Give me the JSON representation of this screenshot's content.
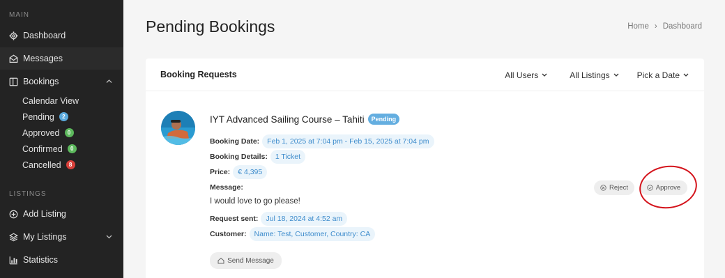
{
  "sidebar": {
    "main_section": "MAIN",
    "items": [
      {
        "label": "Dashboard",
        "icon": "gear-icon"
      },
      {
        "label": "Messages",
        "icon": "envelope-icon"
      },
      {
        "label": "Bookings",
        "icon": "booking-icon"
      }
    ],
    "booking_subitems": [
      {
        "label": "Calendar View"
      },
      {
        "label": "Pending",
        "count": "2",
        "color": "#5aa9dc"
      },
      {
        "label": "Approved",
        "count": "0",
        "color": "#5cb85c"
      },
      {
        "label": "Confirmed",
        "count": "0",
        "color": "#5cb85c"
      },
      {
        "label": "Cancelled",
        "count": "8",
        "color": "#d9403a"
      }
    ],
    "listings_section": "LISTINGS",
    "listing_items": [
      {
        "label": "Add Listing",
        "icon": "plus-circle-icon"
      },
      {
        "label": "My Listings",
        "icon": "layers-icon"
      },
      {
        "label": "Statistics",
        "icon": "bar-chart-icon"
      }
    ]
  },
  "header": {
    "title": "Pending Bookings",
    "breadcrumb": [
      "Home",
      "Dashboard"
    ],
    "breadcrumb_sep": "›"
  },
  "card": {
    "title": "Booking Requests",
    "filters": [
      "All Users",
      "All Listings",
      "Pick a Date"
    ]
  },
  "booking": {
    "listing_title": "IYT Advanced Sailing Course – Tahiti",
    "status": "Pending",
    "date_label": "Booking Date:",
    "date_value": "Feb 1, 2025 at 7:04 pm - Feb 15, 2025 at 7:04 pm",
    "details_label": "Booking Details:",
    "details_value": "1 Ticket",
    "price_label": "Price:",
    "price_value": "€ 4,395",
    "message_label": "Message:",
    "message_value": "I would love to go please!",
    "request_label": "Request sent:",
    "request_value": "Jul 18, 2024 at 4:52 am",
    "customer_label": "Customer:",
    "customer_value": "Name: Test, Customer, Country: CA"
  },
  "actions": {
    "reject_label": "Reject",
    "approve_label": "Approve",
    "send_message_label": "Send Message"
  },
  "colors": {
    "annotation": "#d4141c",
    "accent": "#3e8ccc"
  }
}
